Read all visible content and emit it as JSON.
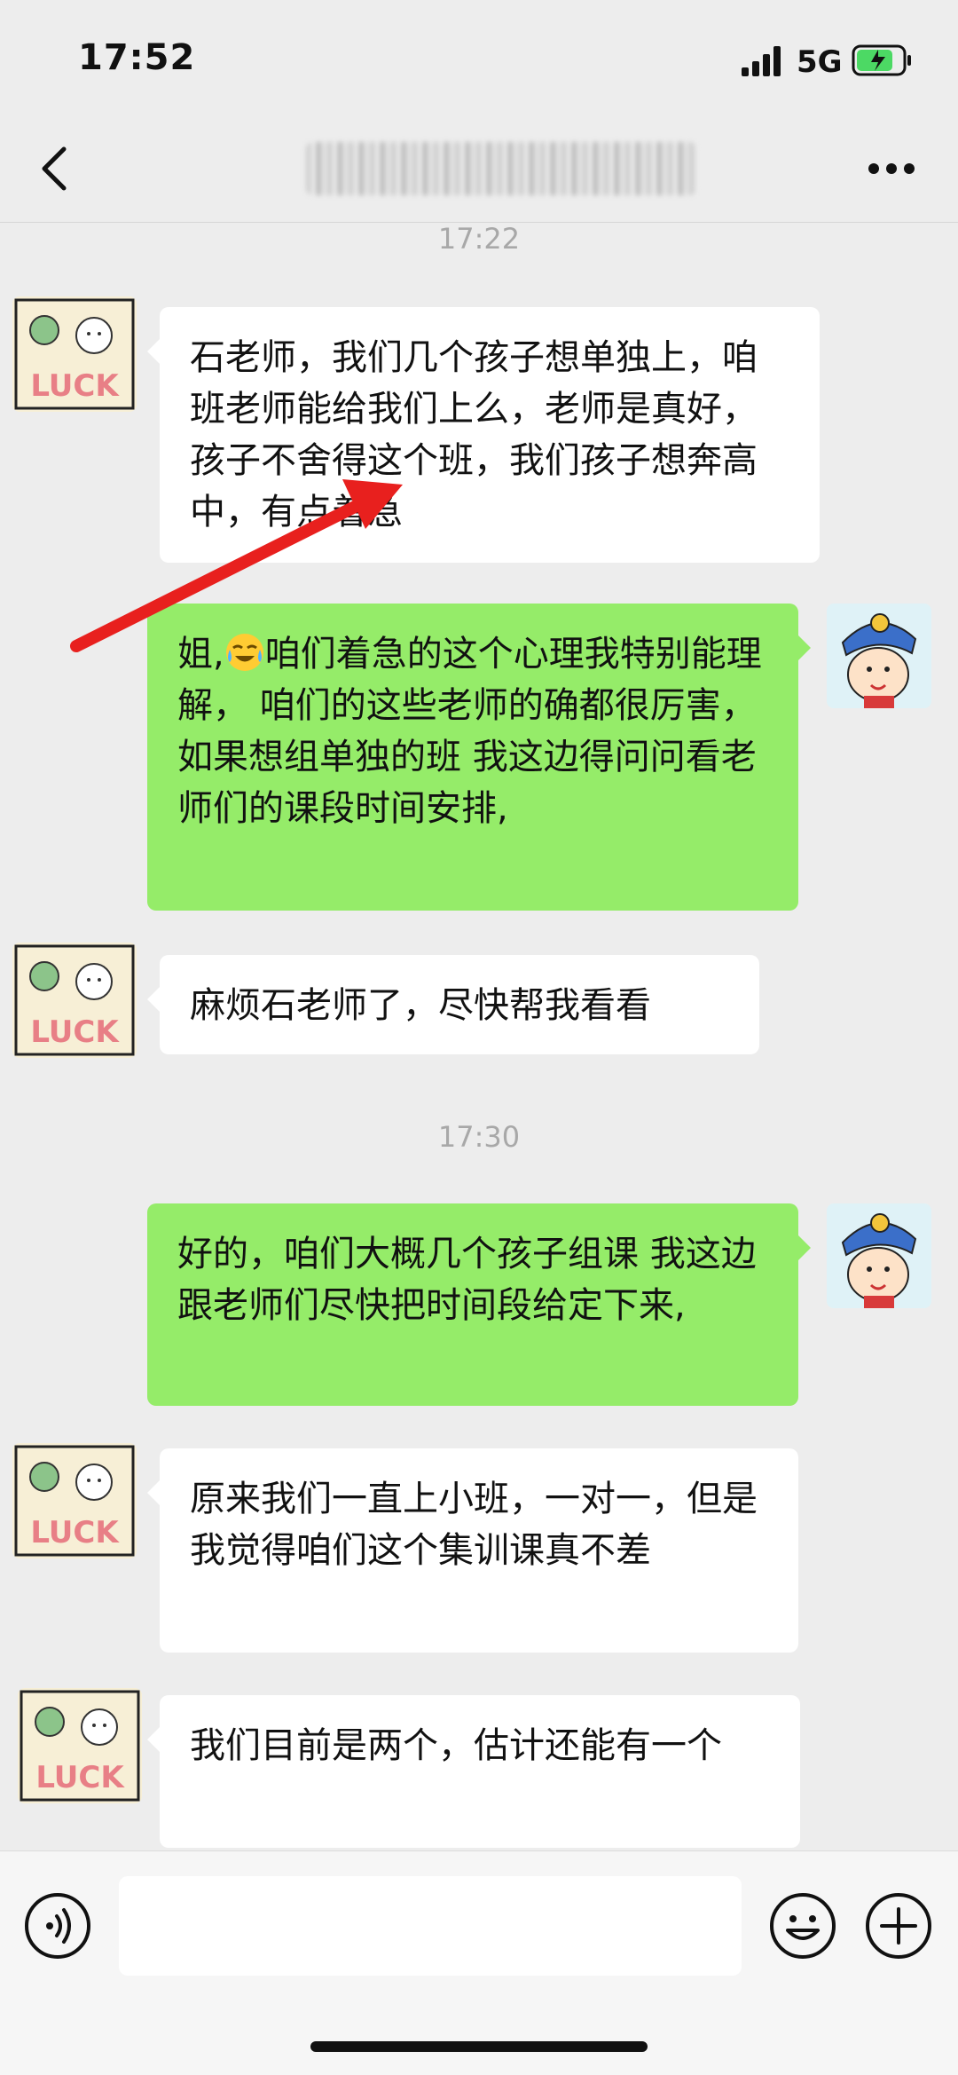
{
  "status_bar": {
    "time": "17:52",
    "network": "5G"
  },
  "nav": {
    "back_icon": "chevron-left-icon",
    "more_icon": "more-dots-icon"
  },
  "colors": {
    "background": "#ededed",
    "outgoing_bubble": "#95ec69",
    "incoming_bubble": "#ffffff",
    "annotation_arrow": "#e8201e",
    "battery": "#4cd964"
  },
  "messages": [
    {
      "type": "timestamp",
      "text": "17:22"
    },
    {
      "type": "incoming",
      "avatar": "luck-sticker-avatar",
      "text": "石老师，我们几个孩子想单独上，咱班老师能给我们上么，老师是真好，孩子不舍得这个班，我们孩子想奔高中，有点着急"
    },
    {
      "type": "outgoing",
      "avatar": "cartoon-boy-avatar",
      "prefix": "姐,",
      "emoji": "crying-laughing-emoji",
      "text": "咱们着急的这个心理我特别能理解， 咱们的这些老师的确都很厉害，如果想组单独的班 我这边得问问看老师们的课段时间安排,"
    },
    {
      "type": "incoming",
      "avatar": "luck-sticker-avatar",
      "text": "麻烦石老师了，尽快帮我看看"
    },
    {
      "type": "timestamp",
      "text": "17:30"
    },
    {
      "type": "outgoing",
      "avatar": "cartoon-boy-avatar",
      "text": "好的，咱们大概几个孩子组课 我这边跟老师们尽快把时间段给定下来,"
    },
    {
      "type": "incoming",
      "avatar": "luck-sticker-avatar",
      "text": "原来我们一直上小班，一对一，但是我觉得咱们这个集训课真不差"
    },
    {
      "type": "incoming",
      "avatar": "luck-sticker-avatar",
      "text": "我们目前是两个，估计还能有一个"
    }
  ],
  "input_bar": {
    "voice_icon": "voice-icon",
    "input_value": "",
    "emoji_icon": "smiley-icon",
    "plus_icon": "plus-circle-icon"
  }
}
